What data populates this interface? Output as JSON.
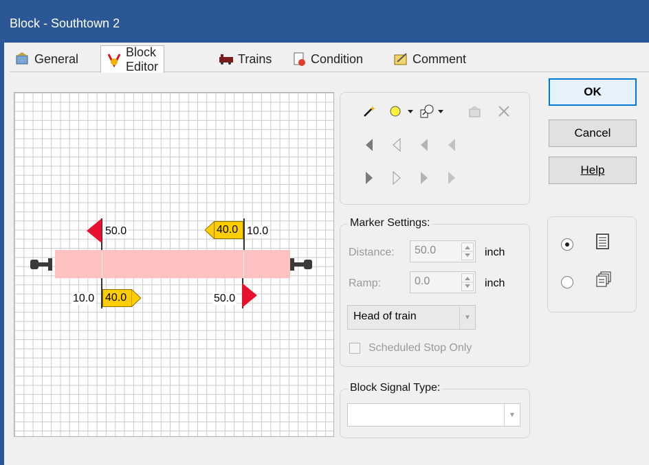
{
  "window": {
    "title": "Block - Southtown 2"
  },
  "tabs": [
    {
      "label": "General",
      "icon": "general-icon"
    },
    {
      "label": "Block Editor",
      "icon": "block-editor-icon",
      "active": true
    },
    {
      "label": "Trains",
      "icon": "trains-icon"
    },
    {
      "label": "Condition",
      "icon": "condition-icon"
    },
    {
      "label": "Comment",
      "icon": "comment-icon"
    }
  ],
  "editor": {
    "markers": {
      "top_left_label": "50.0",
      "top_right_flag": "40.0",
      "top_right_label": "10.0",
      "bottom_left_label": "10.0",
      "bottom_left_flag": "40.0",
      "bottom_right_label": "50.0"
    },
    "colors": {
      "stop_marker": "#e8102f",
      "speed_marker": "#ffcd00",
      "block": "#ffc1c1"
    }
  },
  "toolbar": {
    "icons": [
      "magic-wand-icon",
      "circle-marker-icon",
      "dropdown-arrow-icon",
      "signal-icon",
      "dropdown-arrow-icon",
      "properties-icon",
      "delete-icon"
    ],
    "left_markers": [
      "marker-left-solid-icon",
      "marker-left-outline-icon",
      "marker-left-gray-icon",
      "marker-left-light-icon"
    ],
    "right_markers": [
      "marker-right-solid-icon",
      "marker-right-outline-icon",
      "marker-right-gray-icon",
      "marker-right-light-icon"
    ]
  },
  "marker_settings": {
    "legend": "Marker Settings:",
    "distance_label": "Distance:",
    "distance_value": "50.0",
    "distance_unit": "inch",
    "ramp_label": "Ramp:",
    "ramp_value": "0.0",
    "ramp_unit": "inch",
    "position_value": "Head of train",
    "scheduled_stop_label": "Scheduled Stop Only"
  },
  "block_signal": {
    "legend": "Block Signal Type:",
    "value": ""
  },
  "buttons": {
    "ok": "OK",
    "cancel": "Cancel",
    "help": "Help"
  },
  "view_mode": {
    "options": [
      "list-view-icon",
      "multi-view-icon"
    ],
    "selected_index": 0
  }
}
